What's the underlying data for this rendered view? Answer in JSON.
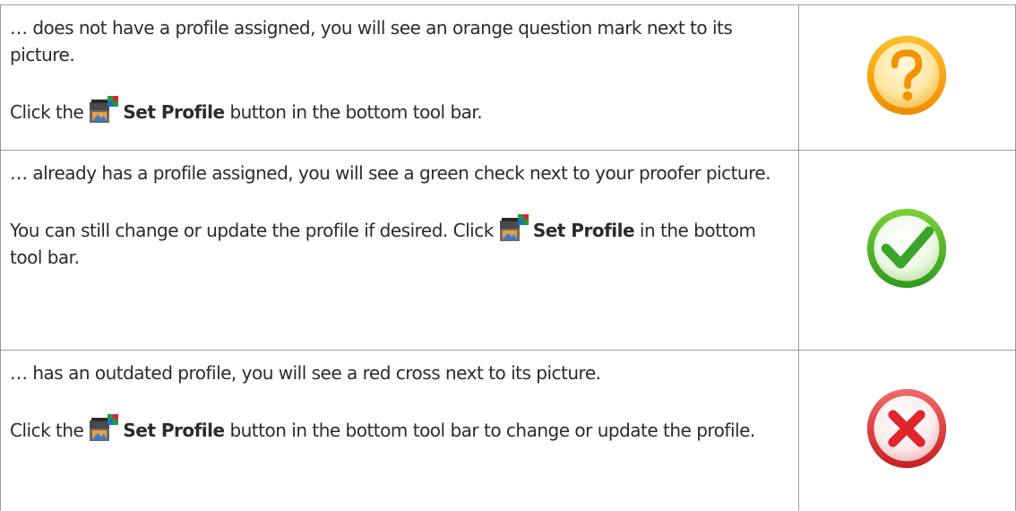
{
  "rows": [
    {
      "line1": "… does not have a profile assigned, you will see an orange question mark next to its picture.",
      "instruction_prefix": "Click the",
      "button_name": "Set Profile",
      "instruction_suffix": "button in the bottom tool bar.",
      "status_icon": "orange-question-icon",
      "status_color": "#f5a623"
    },
    {
      "line1": "… already has a profile assigned, you will see a green check next to your proofer picture.",
      "instruction_prefix": "You can still change or update the profile if desired. Click",
      "button_name": "Set Profile",
      "instruction_suffix": "in the bottom tool bar.",
      "status_icon": "green-check-icon",
      "status_color": "#3aa52a"
    },
    {
      "line1": "… has an outdated profile, you will see a red cross next to its picture.",
      "instruction_prefix": "Click the",
      "button_name": "Set Profile",
      "instruction_suffix": "button in the bottom tool bar to change or update the profile.",
      "status_icon": "red-cross-icon",
      "status_color": "#e0262b"
    }
  ],
  "set_profile_icon": "set-profile-icon"
}
